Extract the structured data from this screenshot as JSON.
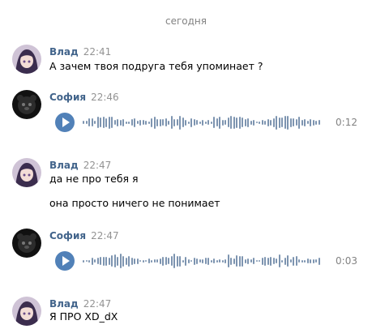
{
  "date_separator": "сегодня",
  "colors": {
    "author": "#42648b",
    "time": "#939393",
    "play": "#5181b8",
    "wave": "#7d94b0"
  },
  "messages": [
    {
      "author": "Влад",
      "time": "22:41",
      "lines": [
        "А зачем твоя подруга тебя упоминает ?"
      ]
    },
    {
      "author": "София",
      "time": "22:46",
      "voice": {
        "duration": "0:12"
      }
    },
    {
      "author": "Влад",
      "time": "22:47",
      "lines": [
        "да не про тебя я",
        "она просто ничего не понимает"
      ]
    },
    {
      "author": "София",
      "time": "22:47",
      "voice": {
        "duration": "0:03"
      }
    },
    {
      "author": "Влад",
      "time": "22:47",
      "lines": [
        "Я ПРО XD_dX"
      ]
    }
  ]
}
